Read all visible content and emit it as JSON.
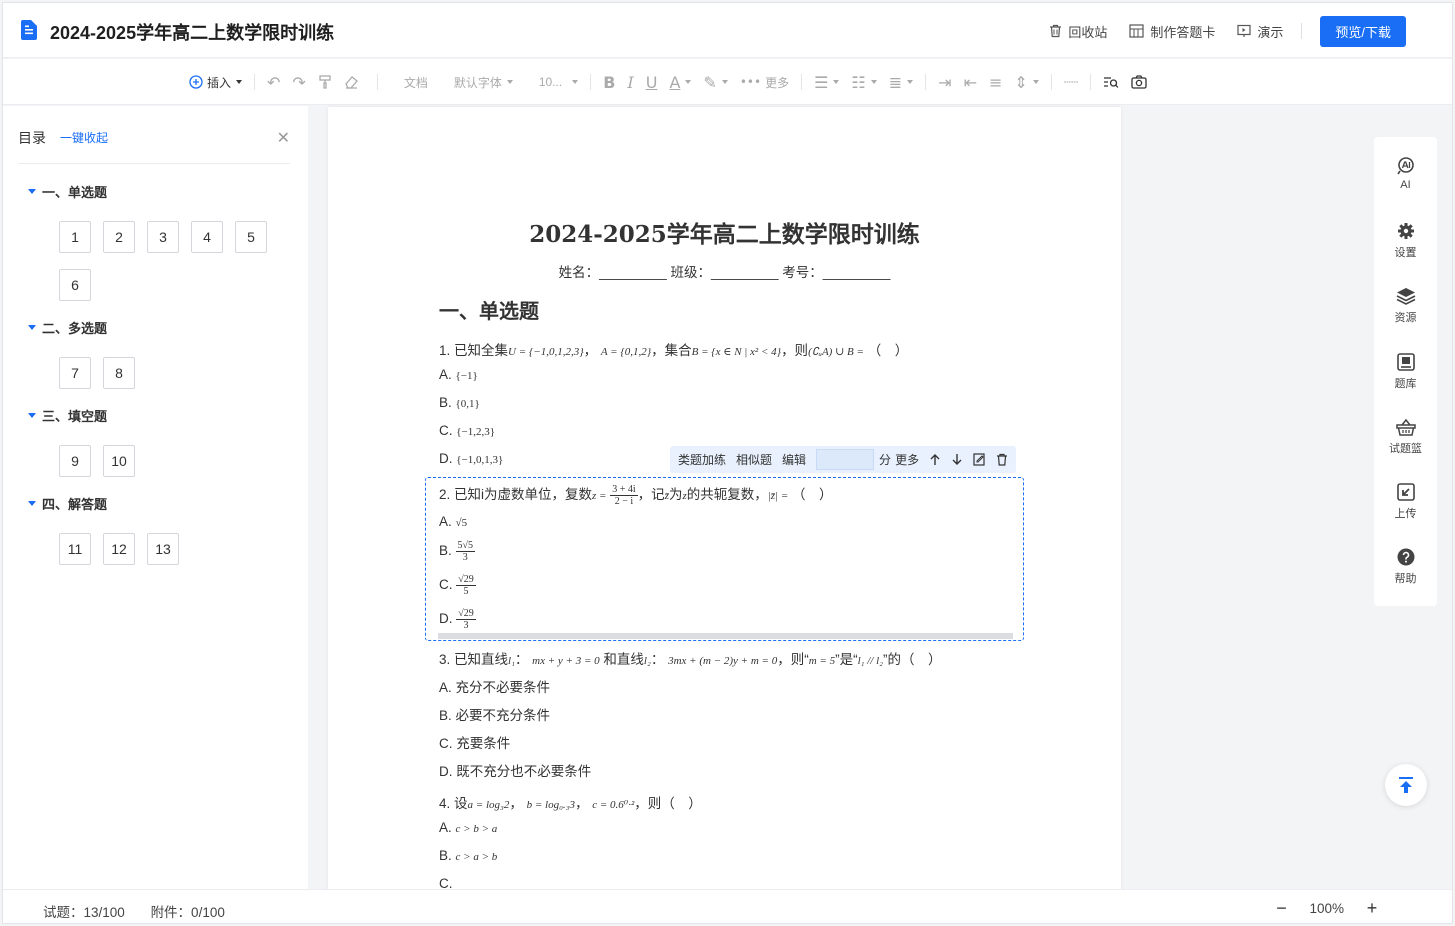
{
  "header": {
    "title": "2024-2025学年高二上数学限时训练",
    "recycle": "回收站",
    "answer_card": "制作答题卡",
    "present": "演示",
    "preview_download": "预览/下载"
  },
  "toolbar": {
    "insert": "插入",
    "style": "文档",
    "font": "默认字体",
    "size": "10...",
    "more": "更多"
  },
  "sidebar": {
    "title": "目录",
    "collapse_all": "一键收起",
    "sections": [
      {
        "label": "一、单选题",
        "questions": [
          "1",
          "2",
          "3",
          "4",
          "5",
          "6"
        ]
      },
      {
        "label": "二、多选题",
        "questions": [
          "7",
          "8"
        ]
      },
      {
        "label": "三、填空题",
        "questions": [
          "9",
          "10"
        ]
      },
      {
        "label": "四、解答题",
        "questions": [
          "11",
          "12",
          "13"
        ]
      }
    ]
  },
  "document": {
    "title": "2024-2025学年高二上数学限时训练",
    "subtitle": "姓名：_________ 班级：_________ 考号：_________",
    "section1": "一、单选题",
    "q1": {
      "stem_a": "1. 已知全集",
      "set_u": "U = {−1,0,1,2,3}",
      "sep": "，",
      "set_a": "A = {0,1,2}",
      "stem_b": "，集合",
      "set_b": "B = {x ∈ N | x² < 4}",
      "stem_c": "，则",
      "expr": "(∁ᵤA) ∪ B =",
      "blank": "（　）",
      "options": [
        {
          "label": "A.",
          "value": "{−1}"
        },
        {
          "label": "B.",
          "value": "{0,1}"
        },
        {
          "label": "C.",
          "value": "{−1,2,3}"
        },
        {
          "label": "D.",
          "value": "{−1,0,1,3}"
        }
      ]
    },
    "q2": {
      "stem_a": "2. 已知i为虚数单位，复数",
      "z_eq": "z =",
      "frac_num": "3 + 4i",
      "frac_den": "2 − i",
      "stem_b": "，记",
      "zbar": "z̄",
      "stem_c": "为",
      "z": "z",
      "stem_d": "的共轭复数，",
      "abs": "|z̄| =",
      "blank": "（　）",
      "options": [
        {
          "label": "A.",
          "num": "√5",
          "den": ""
        },
        {
          "label": "B.",
          "num": "5√5",
          "den": "3"
        },
        {
          "label": "C.",
          "num": "√29",
          "den": "5"
        },
        {
          "label": "D.",
          "num": "√29",
          "den": "3"
        }
      ]
    },
    "q3": {
      "stem_a": "3. 已知直线",
      "l1": "l₁",
      "colon": "：",
      "eq1": "mx + y + 3 = 0",
      "stem_b": "和直线",
      "l2": "l₂",
      "eq2": "3mx + (m − 2)y + m = 0",
      "stem_c": "，则“",
      "cond": "m = 5",
      "stem_d": "”是“",
      "rel": "l₁ // l₂",
      "stem_e": "”的（　）",
      "options": [
        {
          "label": "A.",
          "value": "充分不必要条件"
        },
        {
          "label": "B.",
          "value": "必要不充分条件"
        },
        {
          "label": "C.",
          "value": "充要条件"
        },
        {
          "label": "D.",
          "value": "既不充分也不必要条件"
        }
      ]
    },
    "q4": {
      "stem_a": "4. 设",
      "a": "a = log₃2",
      "b": "b = log₀.₃3",
      "c": "c = 0.6⁰·²",
      "sep": "，",
      "stem_b": "，则（　）",
      "options": [
        {
          "label": "A.",
          "value": "c > b > a"
        },
        {
          "label": "B.",
          "value": "c > a > b"
        },
        {
          "label": "C.",
          "value": ""
        }
      ]
    }
  },
  "floatbar": {
    "similar_plus": "类题加练",
    "similar": "相似题",
    "edit": "编辑",
    "score_unit": "分",
    "more": "更多"
  },
  "rail": {
    "ai": "AI",
    "settings": "设置",
    "resources": "资源",
    "bank": "题库",
    "basket": "试题篮",
    "upload": "上传",
    "help": "帮助"
  },
  "footer": {
    "questions": "试题：13/100",
    "attachments": "附件：0/100",
    "zoom_minus": "−",
    "zoom": "100%",
    "zoom_plus": "+"
  },
  "colors": {
    "accent": "#1a6ef5",
    "float_bar": "#e8f1fd"
  }
}
